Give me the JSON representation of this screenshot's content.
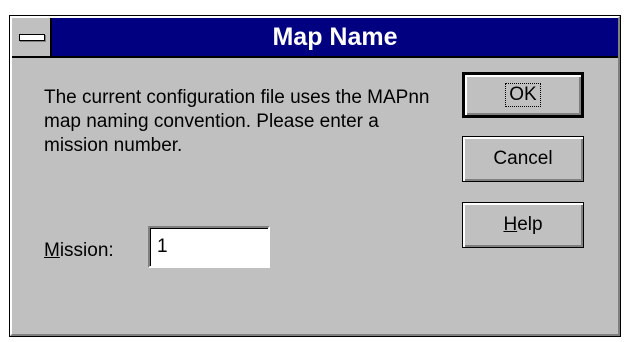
{
  "window": {
    "title": "Map Name"
  },
  "message": "The current configuration file uses the MAPnn map naming convention.  Please enter a mission number.",
  "mission": {
    "label_accel": "M",
    "label_rest": "ission:",
    "value": "1"
  },
  "buttons": {
    "ok": "OK",
    "cancel": "Cancel",
    "help_accel": "H",
    "help_rest": "elp"
  },
  "colors": {
    "titlebar": "#000080",
    "dialog_face": "#c0c0c0"
  },
  "icons": {
    "system_menu": "system-menu-icon"
  }
}
